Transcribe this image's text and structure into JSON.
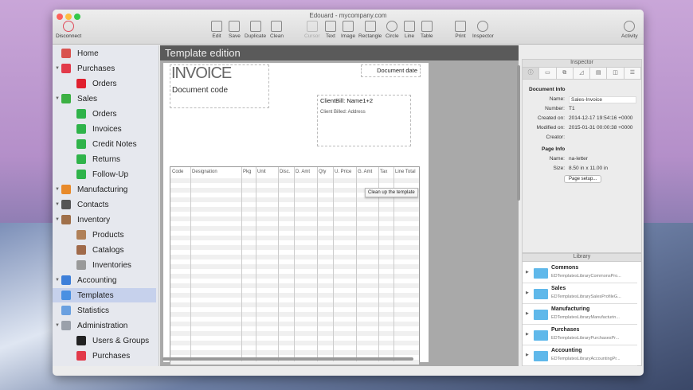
{
  "window": {
    "title": "Edouard - mycompany.com"
  },
  "toolbar": {
    "disconnect": "Disconnect",
    "edit": "Edit",
    "save": "Save",
    "duplicate": "Duplicate",
    "clean": "Clean",
    "cursor": "Cursor",
    "text": "Text",
    "image": "Image",
    "rectangle": "Rectangle",
    "circle": "Circle",
    "line": "Line",
    "table": "Table",
    "print": "Print",
    "inspector": "Inspector",
    "activity": "Activity"
  },
  "sidebar": {
    "items": [
      {
        "label": "Home",
        "color": "#d9534f"
      },
      {
        "label": "Purchases",
        "color": "#e23a4a"
      },
      {
        "label": "Orders",
        "color": "#e0202e"
      },
      {
        "label": "Sales",
        "color": "#3cb043"
      },
      {
        "label": "Orders",
        "color": "#2fb34a"
      },
      {
        "label": "Invoices",
        "color": "#2fb34a"
      },
      {
        "label": "Credit Notes",
        "color": "#2fb34a"
      },
      {
        "label": "Returns",
        "color": "#2fb34a"
      },
      {
        "label": "Follow-Up",
        "color": "#2fb34a"
      },
      {
        "label": "Manufacturing",
        "color": "#e88a2a"
      },
      {
        "label": "Contacts",
        "color": "#555555"
      },
      {
        "label": "Inventory",
        "color": "#a0704a"
      },
      {
        "label": "Products",
        "color": "#b08058"
      },
      {
        "label": "Catalogs",
        "color": "#a06a4a"
      },
      {
        "label": "Inventories",
        "color": "#999999"
      },
      {
        "label": "Accounting",
        "color": "#3d7fd9"
      },
      {
        "label": "Templates",
        "color": "#4a90e2"
      },
      {
        "label": "Statistics",
        "color": "#6aa0e0"
      },
      {
        "label": "Administration",
        "color": "#9aa0aa"
      },
      {
        "label": "Users & Groups",
        "color": "#222222"
      },
      {
        "label": "Purchases",
        "color": "#e23a4a"
      }
    ]
  },
  "editor": {
    "header": "Template edition",
    "invoice_title": "INVOICE",
    "document_code": "Document code",
    "document_date": "Document date",
    "client_name": "ClientBill: Name1+2",
    "client_address": "Client Billed: Address",
    "columns": [
      "Code",
      "Designation",
      "Pkg",
      "Unit",
      "Disc.",
      "D. Amt",
      "Qty",
      "U. Price",
      "G. Amt",
      "Tax",
      "Line Total"
    ],
    "tooltip": "Clean up the template"
  },
  "inspector": {
    "title": "Inspector",
    "tabs": [
      "ⓘ",
      "▭",
      "⧉",
      "◿",
      "▤",
      "◫",
      "☰"
    ],
    "doc_info": "Document Info",
    "name_label": "Name:",
    "name_value": "Sales-Invoice",
    "number_label": "Number:",
    "number_value": "T1",
    "created_label": "Created on:",
    "created_value": "2014-12-17 19:54:16 +0000",
    "modified_label": "Modified on:",
    "modified_value": "2015-01-31 00:00:38 +0000",
    "creator_label": "Creator:",
    "page_info": "Page Info",
    "page_name_label": "Name:",
    "page_name_value": "na-letter",
    "size_label": "Size:",
    "size_value": "8.50 in x 11.00 in",
    "page_setup": "Page setup..."
  },
  "library": {
    "title": "Library",
    "items": [
      {
        "name": "Commons",
        "path": "EDTemplatesLibraryCommonsPro..."
      },
      {
        "name": "Sales",
        "path": "EDTemplatesLibrarySalesProfileG..."
      },
      {
        "name": "Manufacturing",
        "path": "EDTemplatesLibraryManufacturin..."
      },
      {
        "name": "Purchases",
        "path": "EDTemplatesLibraryPurchasesPr..."
      },
      {
        "name": "Accounting",
        "path": "EDTemplatesLibraryAccountingPr..."
      }
    ]
  }
}
